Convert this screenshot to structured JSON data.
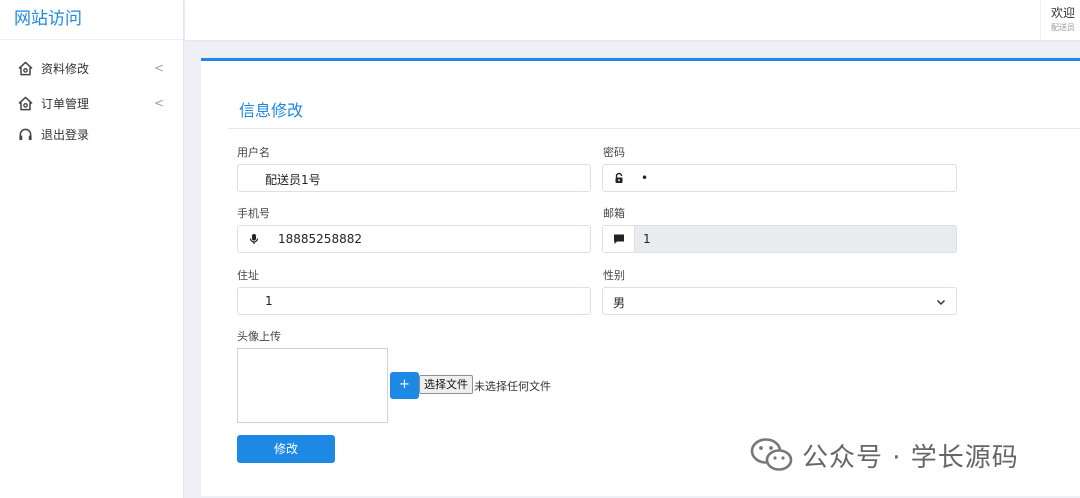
{
  "brand": "网站访问",
  "sidebar": {
    "items": [
      {
        "label": "资料修改",
        "icon": "home-icon",
        "has_submenu": true
      },
      {
        "label": "订单管理",
        "icon": "home-icon",
        "has_submenu": true
      },
      {
        "label": "退出登录",
        "icon": "headset-icon",
        "has_submenu": false
      }
    ],
    "chevron": "<"
  },
  "header": {
    "welcome": "欢迎",
    "sub": "配送员"
  },
  "form": {
    "title": "信息修改",
    "username_label": "用户名",
    "username_value": "配送员1号",
    "password_label": "密码",
    "password_value": "•",
    "phone_label": "手机号",
    "phone_value": "18885258882",
    "email_label": "邮箱",
    "email_value": "1",
    "address_label": "住址",
    "address_value": "1",
    "gender_label": "性别",
    "gender_value": "男",
    "avatar_label": "头像上传",
    "add_label": "+",
    "file_button_label": "选择文件",
    "file_status": "未选择任何文件",
    "submit_label": "修改"
  },
  "watermark": "公众号 · 学长源码",
  "colors": {
    "accent": "#1e88e5",
    "disabled_bg": "#e9ecef"
  }
}
